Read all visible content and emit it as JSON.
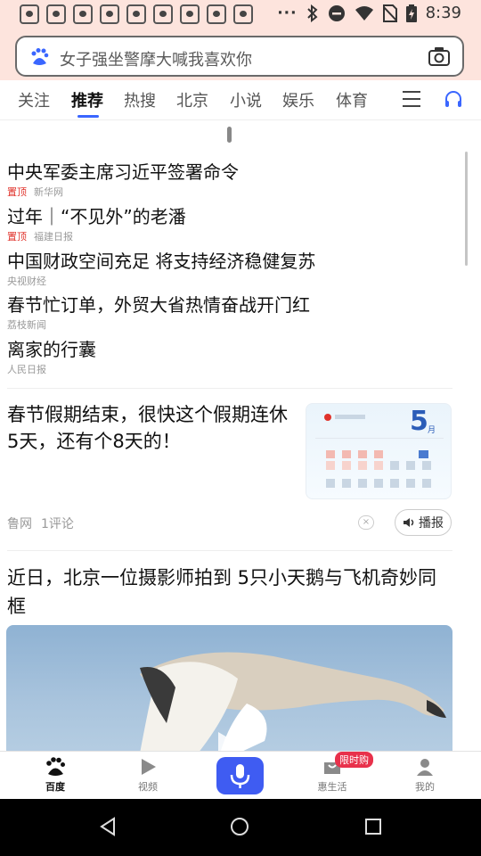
{
  "status_bar": {
    "time": "8:39",
    "notification_count": 9
  },
  "search": {
    "placeholder": "女子强坐警摩大喊我喜欢你"
  },
  "tabs": [
    {
      "label": "关注"
    },
    {
      "label": "推荐",
      "active": true
    },
    {
      "label": "热搜"
    },
    {
      "label": "北京"
    },
    {
      "label": "小说"
    },
    {
      "label": "娱乐"
    },
    {
      "label": "体育"
    }
  ],
  "headlines": [
    {
      "title": "中央军委主席习近平签署命令",
      "pin": "置顶",
      "source": "新华网"
    },
    {
      "title": "过年｜“不见外”的老潘",
      "pin": "置顶",
      "source": "福建日报"
    },
    {
      "title": "中国财政空间充足 将支持经济稳健复苏",
      "pin": "",
      "source": "央视财经"
    },
    {
      "title": "春节忙订单，外贸大省热情奋战开门红",
      "pin": "",
      "source": "荔枝新闻"
    },
    {
      "title": "离家的行囊",
      "pin": "",
      "source": "人民日报"
    }
  ],
  "card": {
    "title": "春节假期结束，很快这个假期连休5天，还有个8天的！",
    "source": "鲁网",
    "comments": "1评论",
    "read_button": "播报",
    "thumb_month": "5",
    "thumb_month_suffix": "月"
  },
  "story": {
    "title": "近日，北京一位摄影师拍到 5只小天鹅与飞机奇妙同框"
  },
  "bottom_nav": [
    {
      "label": "百度",
      "active": true
    },
    {
      "label": "视频"
    },
    {
      "label": ""
    },
    {
      "label": "惠生活",
      "badge": "限时购"
    },
    {
      "label": "我的"
    }
  ],
  "colors": {
    "accent": "#3a66ff",
    "pin_red": "#e0322b",
    "status_bg": "#fde4dd",
    "mic_blue": "#3f5cf2",
    "badge_red": "#e8314b"
  }
}
